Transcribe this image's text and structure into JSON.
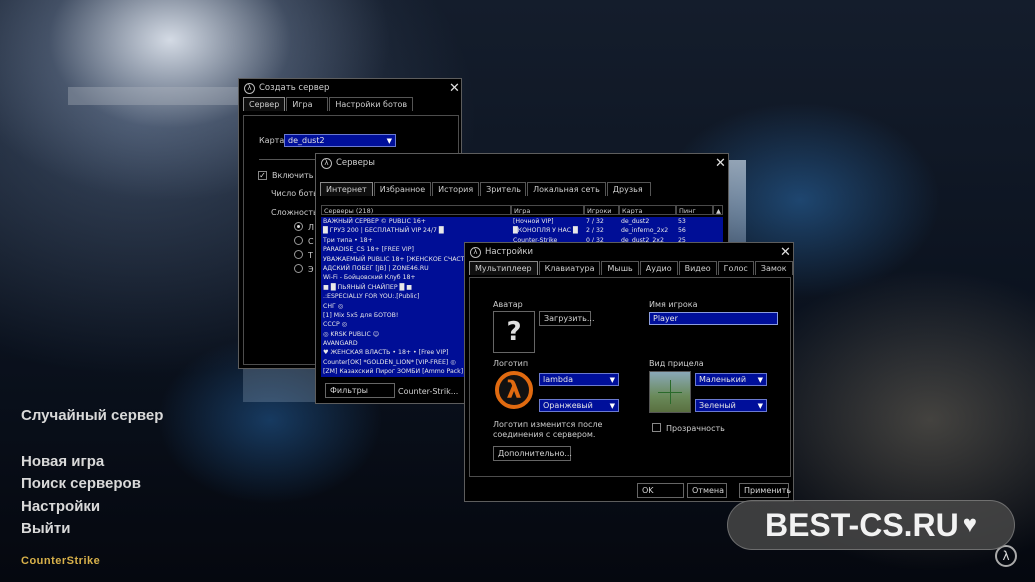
{
  "menu": {
    "items": [
      "Случайный сервер",
      "Новая игра",
      "Поиск серверов",
      "Настройки",
      "Выйти"
    ]
  },
  "logo_text": "CounterStrike",
  "brand_text": "BEST-CS.RU",
  "create_server": {
    "title": "Создать сервер",
    "tabs": [
      "Сервер",
      "Игра",
      "Настройки ботов"
    ],
    "map_label": "Карта",
    "map_value": "de_dust2",
    "enable_bots_label": "Включить б",
    "bot_count_label": "Число боть",
    "difficulty_label": "Сложность",
    "difficulty_options": [
      "Л",
      "С",
      "Т",
      "Э"
    ]
  },
  "servers": {
    "title": "Серверы",
    "tabs": [
      "Интернет",
      "Избранное",
      "История",
      "Зритель",
      "Локальная сеть",
      "Друзья"
    ],
    "columns": [
      "Серверы (218)",
      "Игра",
      "Игроки",
      "Карта",
      "Пинг"
    ],
    "rows": [
      [
        "ВАЖНЫЙ СЕРВЕР © PUBLIC 16+",
        "[Ночной VIP]",
        "7 / 32",
        "de_dust2",
        "53"
      ],
      [
        "█ ГРУЗ 200 | БЕСПЛАТНЫЙ VIP 24/7 █",
        "█КОНОПЛЯ У НАС █",
        "2 / 32",
        "de_inferno_2x2",
        "56"
      ],
      [
        "Три типа • 18+",
        "Counter-Strike",
        "0 / 32",
        "de_dust2_2x2",
        "25"
      ],
      [
        "PARADISE_CS 18+ [FREE VIP]",
        "",
        "",
        "",
        ""
      ],
      [
        "УВАЖАЕМЫЙ PUBLIC 18+ [ЖЕНСКОЕ СЧАСТ",
        "",
        "",
        "",
        ""
      ],
      [
        "АДСКИЙ ПОБЕГ [JB] | ZONE46.RU",
        "",
        "",
        "",
        ""
      ],
      [
        "Wi-Fi - Бойцовский Клуб 18+",
        "",
        "",
        "",
        ""
      ],
      [
        "■ █ ПЬЯНЫЙ СНАЙПЕР █ ■",
        "",
        "",
        "",
        ""
      ],
      [
        ".:ESPECIALLY FOR YOU:.[Public]",
        "",
        "",
        "",
        ""
      ],
      [
        "СНГ ◎",
        "",
        "",
        "",
        ""
      ],
      [
        "[1] Mix 5x5 для БОТОВ!",
        "",
        "",
        "",
        ""
      ],
      [
        "СССР ◎",
        "",
        "",
        "",
        ""
      ],
      [
        "◎ KRSK PUBLIC ☺",
        "",
        "",
        "",
        ""
      ],
      [
        "AVANGARD",
        "",
        "",
        "",
        ""
      ],
      [
        "♥ ЖЕНСКАЯ ВЛАСТЬ • 18+ • [Free VIP]",
        "",
        "",
        "",
        ""
      ],
      [
        "Counter[OK] *GOLDEN_LION* [VIP-FREE] ◎",
        "",
        "",
        "",
        ""
      ],
      [
        "[ZM] Казахский Пирог ЗОМБИ [Ammo Pack]",
        "",
        "",
        "",
        ""
      ]
    ],
    "filters_label": "Фильтры",
    "game_filter": "Counter-Strik..."
  },
  "settings": {
    "title": "Настройки",
    "tabs": [
      "Мультиплеер",
      "Клавиатура",
      "Мышь",
      "Аудио",
      "Видео",
      "Голос",
      "Замок"
    ],
    "avatar_label": "Аватар",
    "avatar_placeholder": "?",
    "upload_button": "Загрузить...",
    "player_name_label": "Имя игрока",
    "player_name_value": "Player",
    "logo_label": "Логотип",
    "logo_select": "lambda",
    "logo_color": "Оранжевый",
    "logo_note": "Логотип изменится после соединения с сервером.",
    "advanced_button": "Дополнительно...",
    "crosshair_label": "Вид прицела",
    "crosshair_size": "Маленький",
    "crosshair_color": "Зеленый",
    "transparency_label": "Прозрачность",
    "ok_button": "OK",
    "cancel_button": "Отмена",
    "apply_button": "Применить"
  }
}
